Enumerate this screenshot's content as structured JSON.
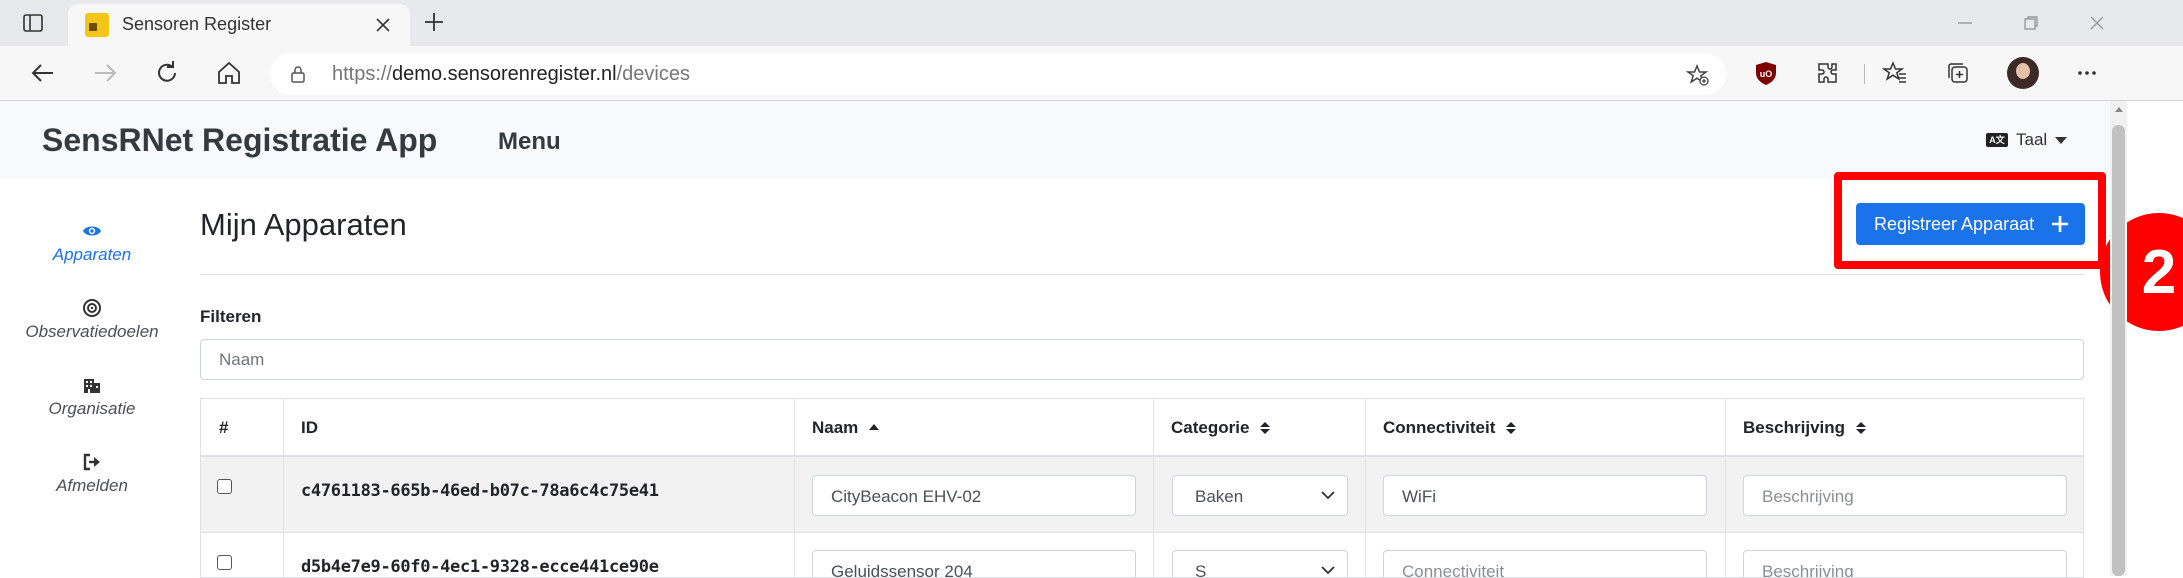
{
  "browser": {
    "tab_title": "Sensoren Register",
    "url_prefix": "https://",
    "url_host": "demo.sensorenregister.nl",
    "url_path": "/devices"
  },
  "app": {
    "brand": "SensRNet Registratie App",
    "menu": "Menu",
    "language": "Taal",
    "language_icon_text": "A文"
  },
  "sidenav": [
    {
      "label": "Apparaten",
      "icon": "eye-icon",
      "active": true
    },
    {
      "label": "Observatiedoelen",
      "icon": "target-icon",
      "active": false
    },
    {
      "label": "Organisatie",
      "icon": "building-icon",
      "active": false
    },
    {
      "label": "Afmelden",
      "icon": "sign-out-icon",
      "active": false
    }
  ],
  "page": {
    "title": "Mijn Apparaten",
    "register_button": "Registreer Apparaat",
    "annotation_number": "2",
    "filter_label": "Filteren",
    "filter_placeholder": "Naam"
  },
  "table": {
    "headers": [
      "#",
      "ID",
      "Naam",
      "Categorie",
      "Connectiviteit",
      "Beschrijving"
    ],
    "rows": [
      {
        "id": "c4761183-665b-46ed-b07c-78a6c4c75e41",
        "naam": "CityBeacon EHV-02",
        "categorie": "Baken",
        "connectiviteit": "WiFi",
        "beschrijving_placeholder": "Beschrijving"
      },
      {
        "id": "d5b4e7e9-60f0-4ec1-9328-ecce441ce90e",
        "naam": "Geluidssensor 204",
        "categorie": "S",
        "connectiviteit_placeholder": "Connectiviteit",
        "beschrijving_placeholder": "Beschrijving"
      }
    ]
  },
  "colors": {
    "accent": "#1a73e8",
    "annotation": "#ff0000"
  }
}
